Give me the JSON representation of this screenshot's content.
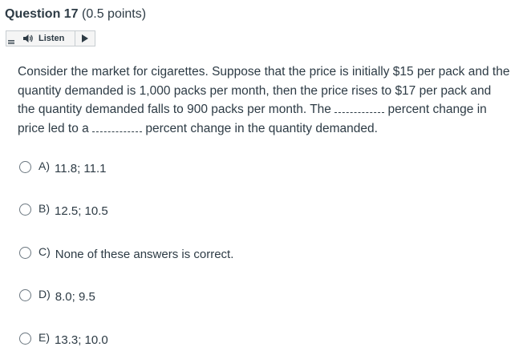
{
  "question": {
    "title": "Question 17",
    "points": "(0.5 points)",
    "text_parts": [
      "Consider the market for cigarettes. Suppose that the price is initially $15 per pack and the quantity demanded is 1,000 packs per month, then the price rises to $17 per pack and the quantity demanded falls to 900 packs per month. The ",
      " percent change in price led to a ",
      " percent change in the quantity demanded."
    ]
  },
  "listen": {
    "label": "Listen",
    "icons": [
      "menu-icon",
      "speaker-icon",
      "play-icon"
    ]
  },
  "options": [
    {
      "letter": "A)",
      "text": "11.8; 11.1"
    },
    {
      "letter": "B)",
      "text": "12.5; 10.5"
    },
    {
      "letter": "C)",
      "text": "None of these answers is correct."
    },
    {
      "letter": "D)",
      "text": "8.0; 9.5"
    },
    {
      "letter": "E)",
      "text": "13.3; 10.0"
    }
  ],
  "colors": {
    "text": "#2d3b45",
    "border": "#c7cdd1",
    "radio_border": "#6b7780"
  }
}
